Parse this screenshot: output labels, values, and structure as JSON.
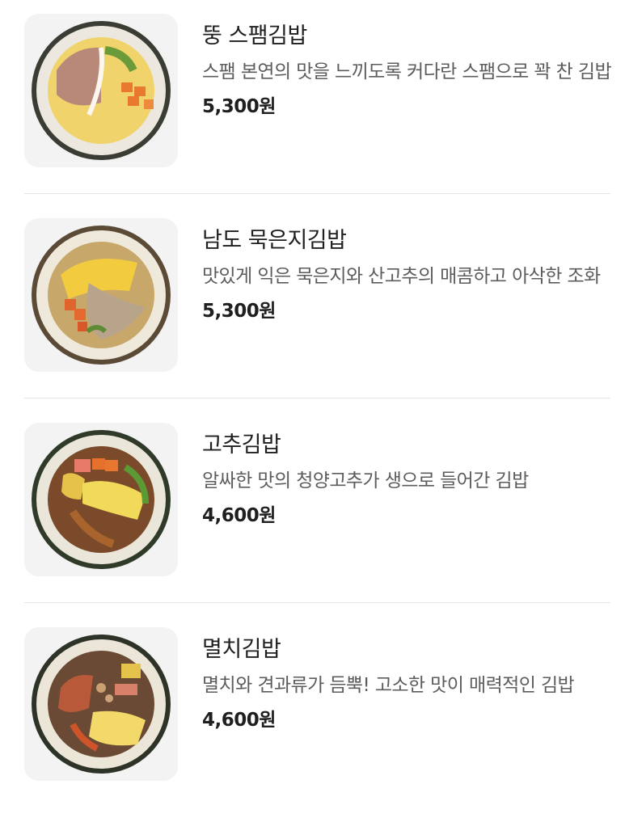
{
  "menu": {
    "items": [
      {
        "name": "뚱 스팸김밥",
        "description": "스팸 본연의 맛을 느끼도록 커다란 스팸으로 꽉 찬 김밥",
        "price": "5,300원",
        "image": "spam-gimbap-photo"
      },
      {
        "name": "남도 묵은지김밥",
        "description": "맛있게 익은 묵은지와 산고추의 매콤하고 아삭한 조화",
        "price": "5,300원",
        "image": "aged-kimchi-gimbap-photo"
      },
      {
        "name": "고추김밥",
        "description": "알싸한 맛의 청양고추가 생으로 들어간 김밥",
        "price": "4,600원",
        "image": "pepper-gimbap-photo"
      },
      {
        "name": "멸치김밥",
        "description": "멸치와 견과류가 듬뿍! 고소한 맛이 매력적인 김밥",
        "price": "4,600원",
        "image": "anchovy-gimbap-photo"
      }
    ]
  }
}
